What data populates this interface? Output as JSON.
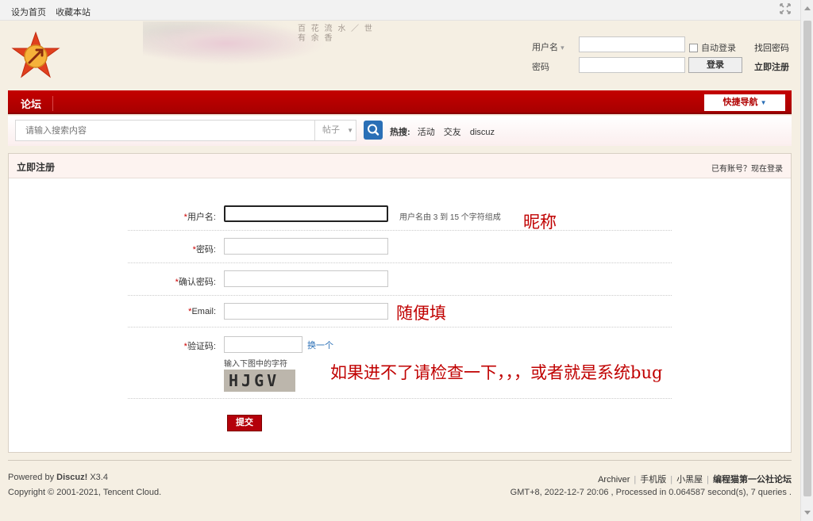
{
  "topbar": {
    "set_home": "设为首页",
    "bookmark": "收藏本站"
  },
  "header": {
    "verse": "百 花 流 水 ／ 世 有 余 香",
    "login": {
      "username_label": "用户名",
      "password_label": "密码",
      "auto_login": "自动登录",
      "login_button": "登录",
      "find_password": "找回密码",
      "register": "立即注册"
    }
  },
  "nav": {
    "forum": "论坛",
    "quick_nav": "快捷导航"
  },
  "search": {
    "placeholder": "请输入搜索内容",
    "type": "帖子",
    "hot_label": "热搜:",
    "hot_items": [
      "活动",
      "交友",
      "discuz"
    ]
  },
  "register": {
    "title": "立即注册",
    "have_account": "已有账号？现在登录",
    "fields": {
      "username": {
        "label": "用户名:",
        "hint": "用户名由 3 到 15 个字符组成"
      },
      "password": {
        "label": "密码:"
      },
      "confirm_password": {
        "label": "确认密码:"
      },
      "email": {
        "label": "Email:"
      },
      "captcha": {
        "label": "验证码:",
        "refresh": "换一个",
        "hint": "输入下图中的字符",
        "image_text": "HJGV"
      }
    },
    "submit": "提交",
    "notes": {
      "username": "昵称",
      "email": "随便填",
      "captcha": "如果进不了请检查一下，，，或者就是系统bug"
    }
  },
  "footer": {
    "powered_prefix": "Powered by",
    "powered_name": "Discuz!",
    "powered_version": "X3.4",
    "copyright": "Copyright © 2001-2021, Tencent Cloud.",
    "links": [
      "Archiver",
      "手机版",
      "小黑屋"
    ],
    "site_name": "编程猫第一公社论坛",
    "stats": "GMT+8, 2022-12-7 20:06 , Processed in 0.064587 second(s), 7 queries ."
  },
  "colors": {
    "brand_red": "#b4000a",
    "note_red": "#c00000",
    "search_blue": "#2a6fb6"
  }
}
